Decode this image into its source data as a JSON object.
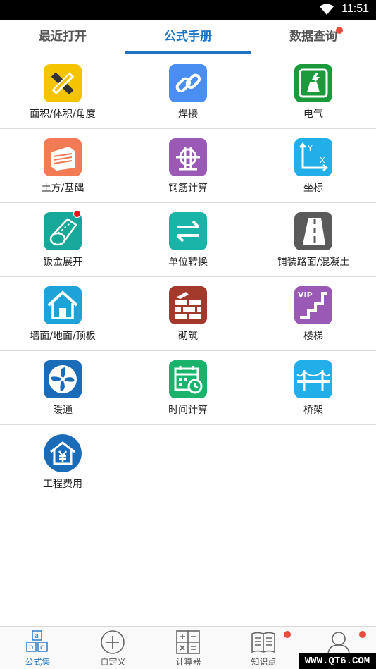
{
  "status_bar": {
    "time": "11:51"
  },
  "top_tabs": [
    {
      "label": "最近打开",
      "active": false
    },
    {
      "label": "公式手册",
      "active": true
    },
    {
      "label": "数据查询",
      "active": false,
      "badge": true
    }
  ],
  "grid": [
    {
      "label": "面积/体积/角度",
      "icon": "ruler-pencil-icon",
      "color": "#f5c400"
    },
    {
      "label": "焊接",
      "icon": "chain-link-icon",
      "color": "#4b8ef2"
    },
    {
      "label": "电气",
      "icon": "electric-plug-icon",
      "color": "#1a9a3a"
    },
    {
      "label": "土方/基础",
      "icon": "earthwork-icon",
      "color": "#f27a55"
    },
    {
      "label": "钢筋计算",
      "icon": "rebar-icon",
      "color": "#9b59b6"
    },
    {
      "label": "坐标",
      "icon": "coordinate-axes-icon",
      "color": "#22aee8"
    },
    {
      "label": "钣金展开",
      "icon": "sheet-metal-icon",
      "color": "#17a89a",
      "badge": true
    },
    {
      "label": "单位转换",
      "icon": "convert-arrows-icon",
      "color": "#1ab3a8"
    },
    {
      "label": "铺装路面/混凝土",
      "icon": "road-icon",
      "color": "#5a5a5a"
    },
    {
      "label": "墙面/地面/顶板",
      "icon": "house-icon",
      "color": "#1ea3d8"
    },
    {
      "label": "砌筑",
      "icon": "brick-wall-icon",
      "color": "#a3392a"
    },
    {
      "label": "楼梯",
      "icon": "stairs-vip-icon",
      "color": "#9b59b6"
    },
    {
      "label": "暖通",
      "icon": "fan-icon",
      "color": "#1a6cb8"
    },
    {
      "label": "时间计算",
      "icon": "calendar-clock-icon",
      "color": "#1ab36b"
    },
    {
      "label": "桥架",
      "icon": "bridge-icon",
      "color": "#22aee8"
    },
    {
      "label": "工程费用",
      "icon": "yen-house-icon",
      "color": "#1a6cb8"
    }
  ],
  "grid_badge_icon_text": "VIP",
  "coordinate_labels": {
    "x": "X",
    "y": "Y"
  },
  "bottom_nav": [
    {
      "label": "公式集",
      "icon": "abc-blocks-icon",
      "active": true
    },
    {
      "label": "自定义",
      "icon": "plus-circle-icon",
      "active": false
    },
    {
      "label": "计算器",
      "icon": "calculator-icon",
      "active": false
    },
    {
      "label": "知识点",
      "icon": "book-icon",
      "active": false,
      "badge": true
    },
    {
      "label": "",
      "icon": "profile-icon",
      "active": false,
      "badge": true
    }
  ],
  "watermark": "WWW.QT6.COM"
}
